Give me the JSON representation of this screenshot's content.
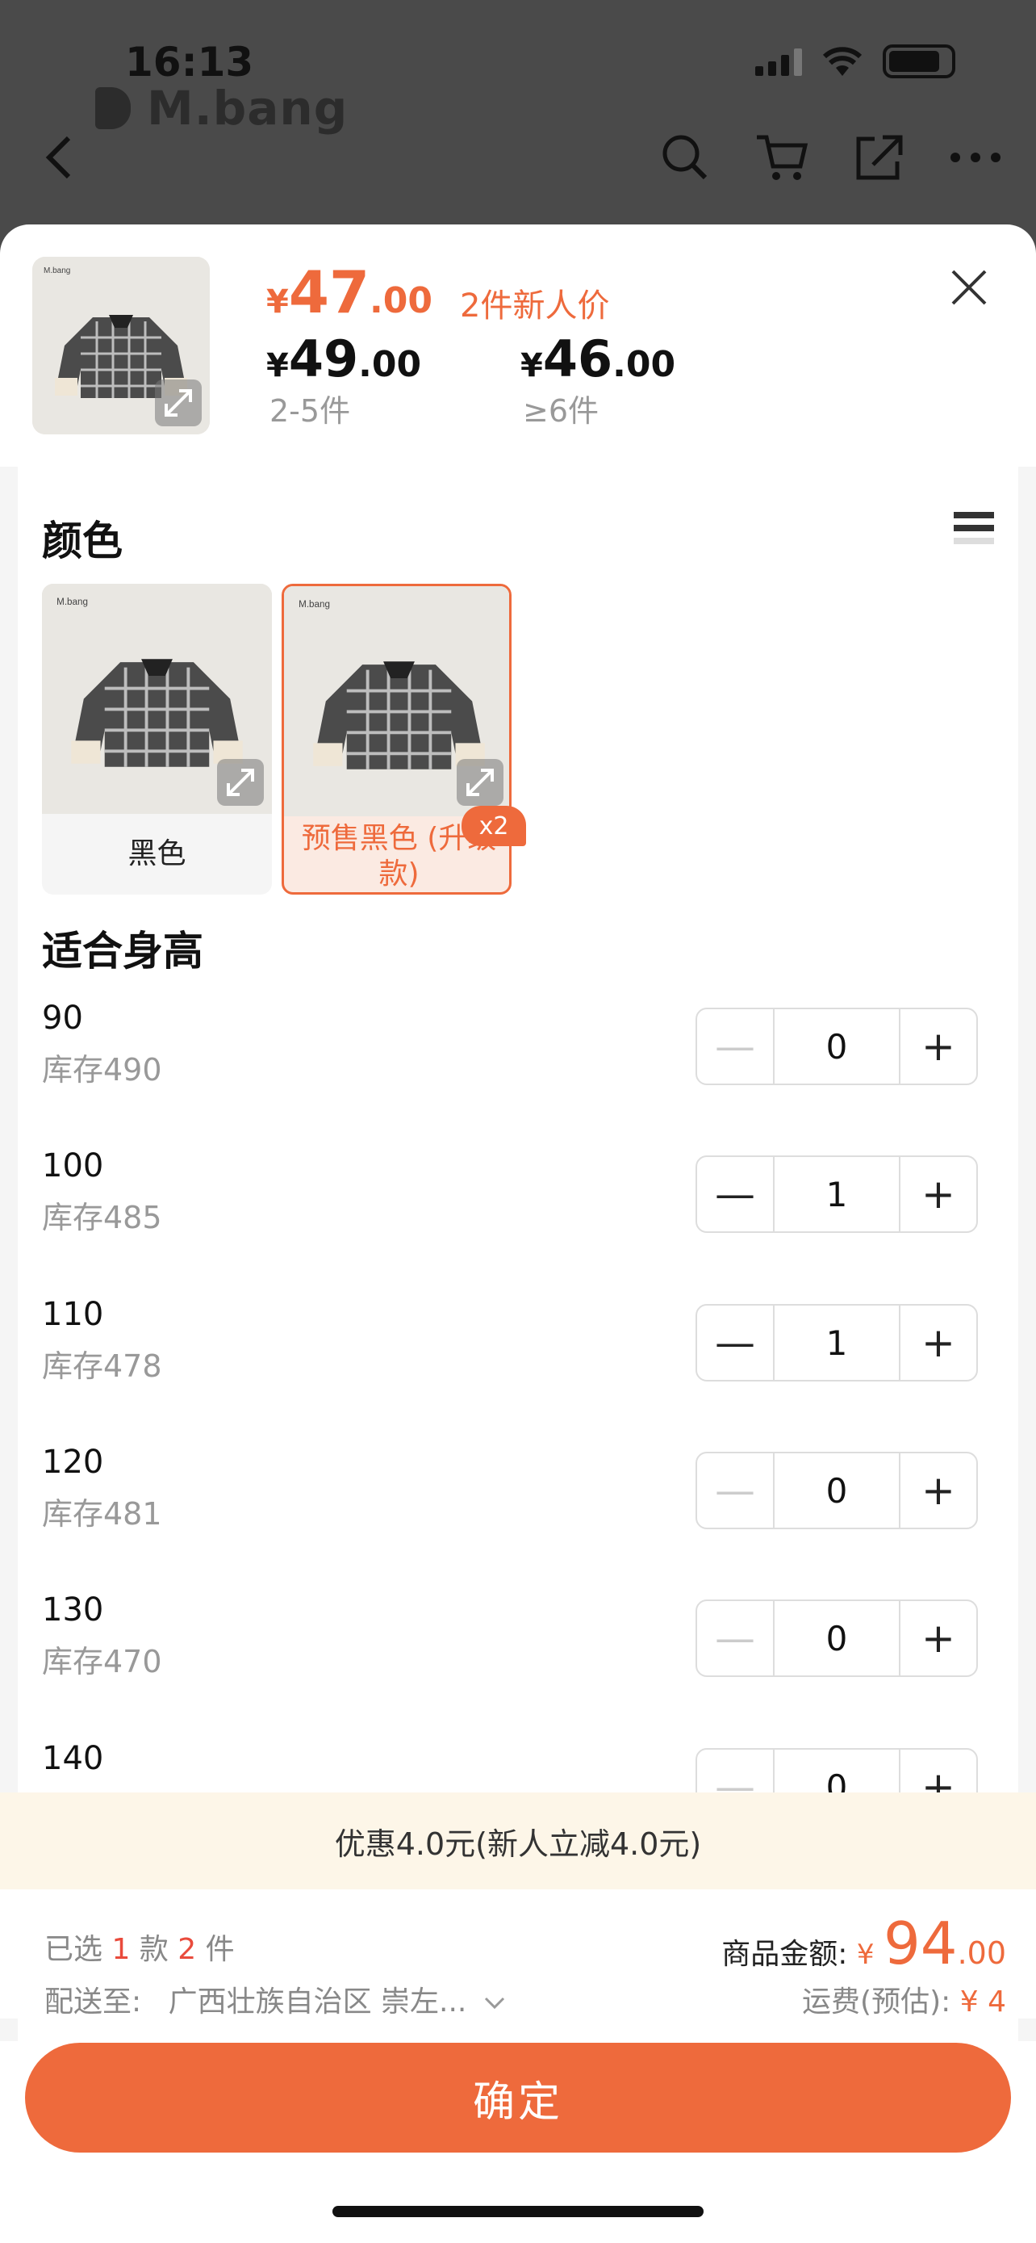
{
  "status": {
    "time": "16:13"
  },
  "header": {
    "brand": "M.bang"
  },
  "product": {
    "price_int": "47",
    "price_dec": ".00",
    "price_tag": "2件新人价",
    "currency": "¥",
    "tiers": [
      {
        "int": "49",
        "dec": ".00",
        "qty": "2-5件"
      },
      {
        "int": "46",
        "dec": ".00",
        "qty": "≥6件"
      }
    ]
  },
  "color_section": {
    "title": "颜色",
    "options": [
      {
        "label": "黑色",
        "selected": false
      },
      {
        "label": "预售黑色 (升级款)",
        "selected": true,
        "badge": "x2"
      }
    ]
  },
  "size_section": {
    "title": "适合身高",
    "rows": [
      {
        "height": "90",
        "stock": "库存490",
        "qty": "0"
      },
      {
        "height": "100",
        "stock": "库存485",
        "qty": "1"
      },
      {
        "height": "110",
        "stock": "库存478",
        "qty": "1"
      },
      {
        "height": "120",
        "stock": "库存481",
        "qty": "0"
      },
      {
        "height": "130",
        "stock": "库存470",
        "qty": "0"
      },
      {
        "height": "140",
        "stock": "",
        "qty": "0"
      }
    ]
  },
  "promo": "优惠4.0元(新人立减4.0元)",
  "summary": {
    "selected_prefix": "已选",
    "styles_count": "1",
    "styles_unit": "款",
    "items_count": "2",
    "items_unit": "件",
    "ship_label": "配送至:",
    "ship_to": "广西壮族自治区 崇左...",
    "total_label": "商品金额:",
    "total_int": "94",
    "total_dec": ".00",
    "fee_label": "运费(预估):",
    "fee_value": "¥ 4"
  },
  "confirm_label": "确定",
  "colors": {
    "accent": "#ee6a3c",
    "promo_bg": "#fdf6e8"
  }
}
